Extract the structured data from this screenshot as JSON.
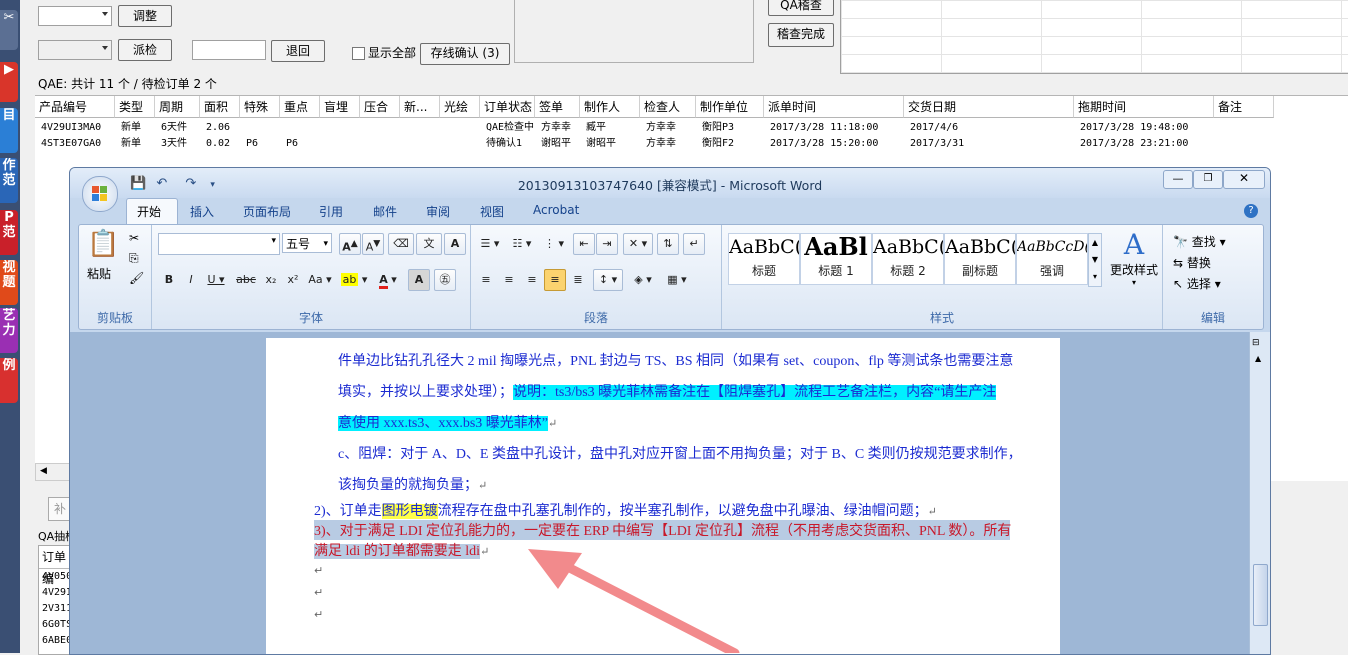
{
  "bg_app": {
    "adjust_btn": "调整",
    "dispatch_btn": "派检",
    "return_btn": "退回",
    "show_all_label": "显示全部",
    "online_confirm_btn": "存线确认 (3)",
    "qa_review_btn": "QA稽查",
    "review_done_btn": "稽查完成",
    "status_line": "QAE: 共计 11 个 / 待检订单 2 个",
    "bottom_tab": "补",
    "qa_label": "QA抽检",
    "bottom_col": "订单编",
    "bottom_rows": [
      "4V050",
      "4V29I",
      "2V311",
      "6G0TS",
      "6ABE0"
    ]
  },
  "grid": {
    "columns": [
      "产品编号",
      "类型",
      "周期",
      "面积",
      "特殊",
      "重点",
      "盲埋",
      "压合",
      "新...",
      "光绘",
      "订单状态",
      "签单",
      "制作人",
      "检查人",
      "制作单位",
      "派单时间",
      "交货日期",
      "拖期时间",
      "备注"
    ],
    "rows": [
      [
        "4V29UI3MA0",
        "新单",
        "6天件",
        "2.06",
        "",
        "",
        "",
        "",
        "",
        "",
        "QAE检查中",
        "方幸幸",
        "臧平",
        "方幸幸",
        "衡阳P3",
        "2017/3/28 11:18:00",
        "2017/4/6",
        "2017/3/28 19:48:00",
        ""
      ],
      [
        "4ST3E07GA0",
        "新单",
        "3天件",
        "0.02",
        "P6",
        "P6",
        "",
        "",
        "",
        "",
        "待确认1",
        "谢昭平",
        "谢昭平",
        "方幸幸",
        "衡阳F2",
        "2017/3/28 15:20:00",
        "2017/3/31",
        "2017/3/28 23:21:00",
        ""
      ]
    ]
  },
  "left_strip": [
    "作范",
    "P范",
    "视题",
    "艺力",
    "例"
  ],
  "word": {
    "title": "20130913103747640 [兼容模式] - Microsoft Word",
    "tabs": [
      "开始",
      "插入",
      "页面布局",
      "引用",
      "邮件",
      "审阅",
      "视图",
      "Acrobat"
    ],
    "groups": {
      "clipboard": "剪贴板",
      "paste": "粘贴",
      "font": "字体",
      "font_size": "五号",
      "paragraph": "段落",
      "styles": "样式",
      "editing": "编辑",
      "change_styles": "更改样式",
      "find": "查找",
      "replace": "替换",
      "select": "选择"
    },
    "styles": [
      {
        "sample": "AaBbC(",
        "name": "标题"
      },
      {
        "sample": "AaBl",
        "name": "标题 1"
      },
      {
        "sample": "AaBbC(",
        "name": "标题 2"
      },
      {
        "sample": "AaBbC(",
        "name": "副标题"
      },
      {
        "sample": "AaBbCcD(",
        "name": "强调"
      }
    ],
    "doc": {
      "l1": "件单边比钻孔孔径大 2 mil 掏曝光点，PNL 封边与 TS、BS 相同（如果有 set、coupon、flp 等测试条也需要注意",
      "l2a": "填实，并按以上要求处理）；",
      "l2b": "说明：ts3/bs3 曝光菲林需备注在【阻焊塞孔】流程工艺备注栏，内容“请生产注",
      "l3": "意使用 xxx.ts3、xxx.bs3 曝光菲林”",
      "l4": "c、阻焊：对于 A、D、E 类盘中孔设计，盘中孔对应开窗上面不用掏负量；对于 B、C 类则仍按规范要求制作，",
      "l5": "该掏负量的就掏负量；",
      "l6a": "2)、订单走",
      "l6b": "图形电镀",
      "l6c": "流程存在盘中孔塞孔制作的，按半塞孔制作，以避免盘中孔曝油、绿油帽问题；",
      "l7": "3)、对于满足 LDI 定位孔能力的，一定要在 ERP 中编写【LDI 定位孔】流程（不用考虑交货面积、PNL 数）。所有",
      "l8": "满足 ldi 的订单都需要走 ldi"
    }
  }
}
